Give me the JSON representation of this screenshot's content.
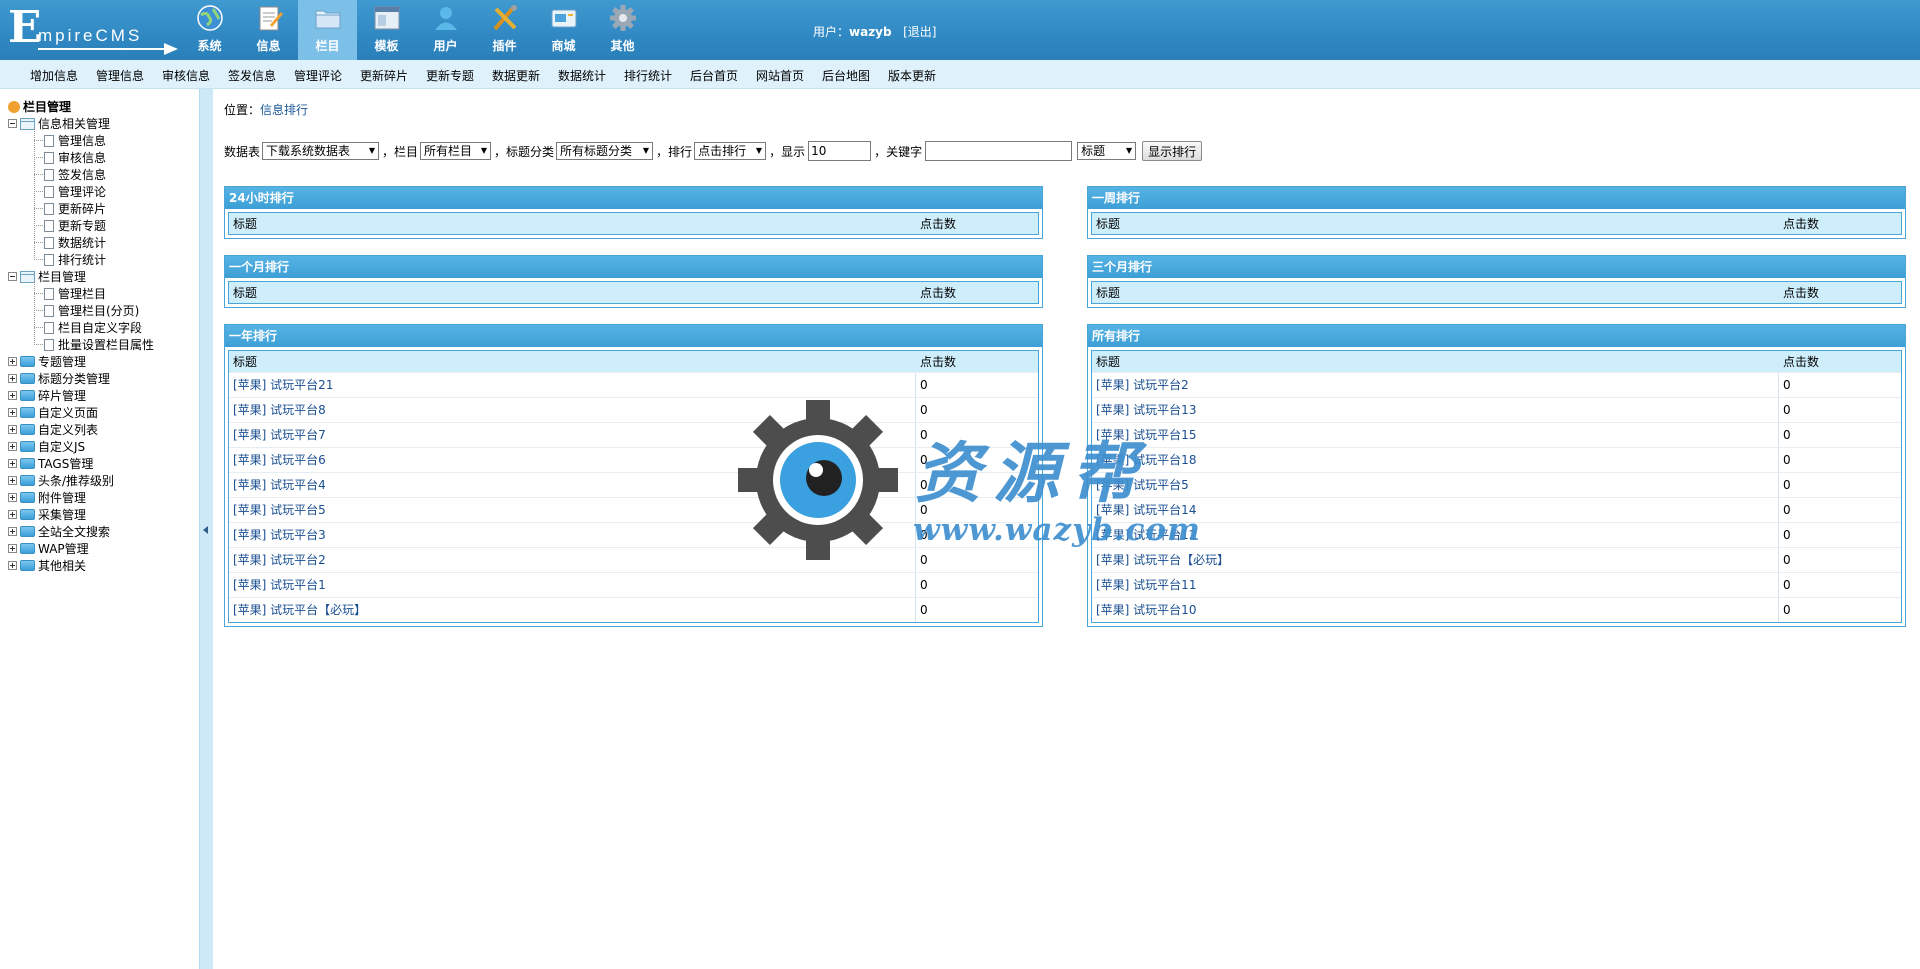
{
  "logo": {
    "first": "E",
    "rest": "mpireCMS"
  },
  "topnav": [
    {
      "label": "系统",
      "icon": "globe-icon"
    },
    {
      "label": "信息",
      "icon": "notepad-icon"
    },
    {
      "label": "栏目",
      "icon": "folder-icon",
      "active": true
    },
    {
      "label": "模板",
      "icon": "window-icon"
    },
    {
      "label": "用户",
      "icon": "user-icon"
    },
    {
      "label": "插件",
      "icon": "tools-icon"
    },
    {
      "label": "商城",
      "icon": "card-icon"
    },
    {
      "label": "其他",
      "icon": "gear-icon"
    }
  ],
  "user": {
    "prefix": "用户：",
    "name": "wazyb",
    "logout": "[退出]"
  },
  "menubar": [
    "增加信息",
    "管理信息",
    "审核信息",
    "签发信息",
    "管理评论",
    "更新碎片",
    "更新专题",
    "数据更新",
    "数据统计",
    "排行统计",
    "后台首页",
    "网站首页",
    "后台地图",
    "版本更新"
  ],
  "sidebar": {
    "root": "栏目管理",
    "groups": [
      {
        "label": "信息相关管理",
        "open": true,
        "children": [
          "管理信息",
          "审核信息",
          "签发信息",
          "管理评论",
          "更新碎片",
          "更新专题",
          "数据统计",
          "排行统计"
        ]
      },
      {
        "label": "栏目管理",
        "open": true,
        "children": [
          "管理栏目",
          "管理栏目(分页)",
          "栏目自定义字段",
          "批量设置栏目属性"
        ]
      },
      {
        "label": "专题管理",
        "open": false,
        "children": []
      },
      {
        "label": "标题分类管理",
        "open": false,
        "children": []
      },
      {
        "label": "碎片管理",
        "open": false,
        "children": []
      },
      {
        "label": "自定义页面",
        "open": false,
        "children": []
      },
      {
        "label": "自定义列表",
        "open": false,
        "children": []
      },
      {
        "label": "自定义JS",
        "open": false,
        "children": []
      },
      {
        "label": "TAGS管理",
        "open": false,
        "children": []
      },
      {
        "label": "头条/推荐级别",
        "open": false,
        "children": []
      },
      {
        "label": "附件管理",
        "open": false,
        "children": []
      },
      {
        "label": "采集管理",
        "open": false,
        "children": []
      },
      {
        "label": "全站全文搜索",
        "open": false,
        "children": []
      },
      {
        "label": "WAP管理",
        "open": false,
        "children": []
      },
      {
        "label": "其他相关",
        "open": false,
        "children": []
      }
    ]
  },
  "breadcrumb": {
    "prefix": "位置：",
    "link": "信息排行"
  },
  "filter": {
    "table_label": "数据表",
    "table_value": "下载系统数据表",
    "column_label": "，栏目",
    "column_value": "所有栏目",
    "category_label": "，标题分类",
    "category_value": "所有标题分类",
    "sort_label": "，排行",
    "sort_value": "点击排行",
    "show_label": "，显示",
    "show_value": "10",
    "keyword_label": "，关键字",
    "keyword_value": "",
    "field_value": "标题",
    "submit": "显示排行"
  },
  "panels": [
    {
      "title": "24小时排行",
      "col_title": "标题",
      "col_clicks": "点击数",
      "rows": []
    },
    {
      "title": "一周排行",
      "col_title": "标题",
      "col_clicks": "点击数",
      "rows": []
    },
    {
      "title": "一个月排行",
      "col_title": "标题",
      "col_clicks": "点击数",
      "rows": []
    },
    {
      "title": "三个月排行",
      "col_title": "标题",
      "col_clicks": "点击数",
      "rows": []
    },
    {
      "title": "一年排行",
      "col_title": "标题",
      "col_clicks": "点击数",
      "rows": [
        {
          "title": "[苹果] 试玩平台21",
          "clicks": "0"
        },
        {
          "title": "[苹果] 试玩平台8",
          "clicks": "0"
        },
        {
          "title": "[苹果] 试玩平台7",
          "clicks": "0"
        },
        {
          "title": "[苹果] 试玩平台6",
          "clicks": "0"
        },
        {
          "title": "[苹果] 试玩平台4",
          "clicks": "0"
        },
        {
          "title": "[苹果] 试玩平台5",
          "clicks": "0"
        },
        {
          "title": "[苹果] 试玩平台3",
          "clicks": "0"
        },
        {
          "title": "[苹果] 试玩平台2",
          "clicks": "0"
        },
        {
          "title": "[苹果] 试玩平台1",
          "clicks": "0"
        },
        {
          "title": "[苹果] 试玩平台【必玩】",
          "clicks": "0"
        }
      ]
    },
    {
      "title": "所有排行",
      "col_title": "标题",
      "col_clicks": "点击数",
      "rows": [
        {
          "title": "[苹果] 试玩平台2",
          "clicks": "0"
        },
        {
          "title": "[苹果] 试玩平台13",
          "clicks": "0"
        },
        {
          "title": "[苹果] 试玩平台15",
          "clicks": "0"
        },
        {
          "title": "[苹果] 试玩平台18",
          "clicks": "0"
        },
        {
          "title": "[苹果] 试玩平台5",
          "clicks": "0"
        },
        {
          "title": "[苹果] 试玩平台14",
          "clicks": "0"
        },
        {
          "title": "[苹果] 试玩平台12",
          "clicks": "0"
        },
        {
          "title": "[苹果] 试玩平台【必玩】",
          "clicks": "0"
        },
        {
          "title": "[苹果] 试玩平台11",
          "clicks": "0"
        },
        {
          "title": "[苹果] 试玩平台10",
          "clicks": "0"
        }
      ]
    }
  ],
  "watermark": {
    "text": "资源帮",
    "url": "www.wazyb.com"
  },
  "colors": {
    "header": "#2e86c1",
    "menubar": "#dff1fb",
    "panel_header": "#3d9fd6",
    "table_head": "#cfeefc",
    "link": "#1a4f91"
  }
}
